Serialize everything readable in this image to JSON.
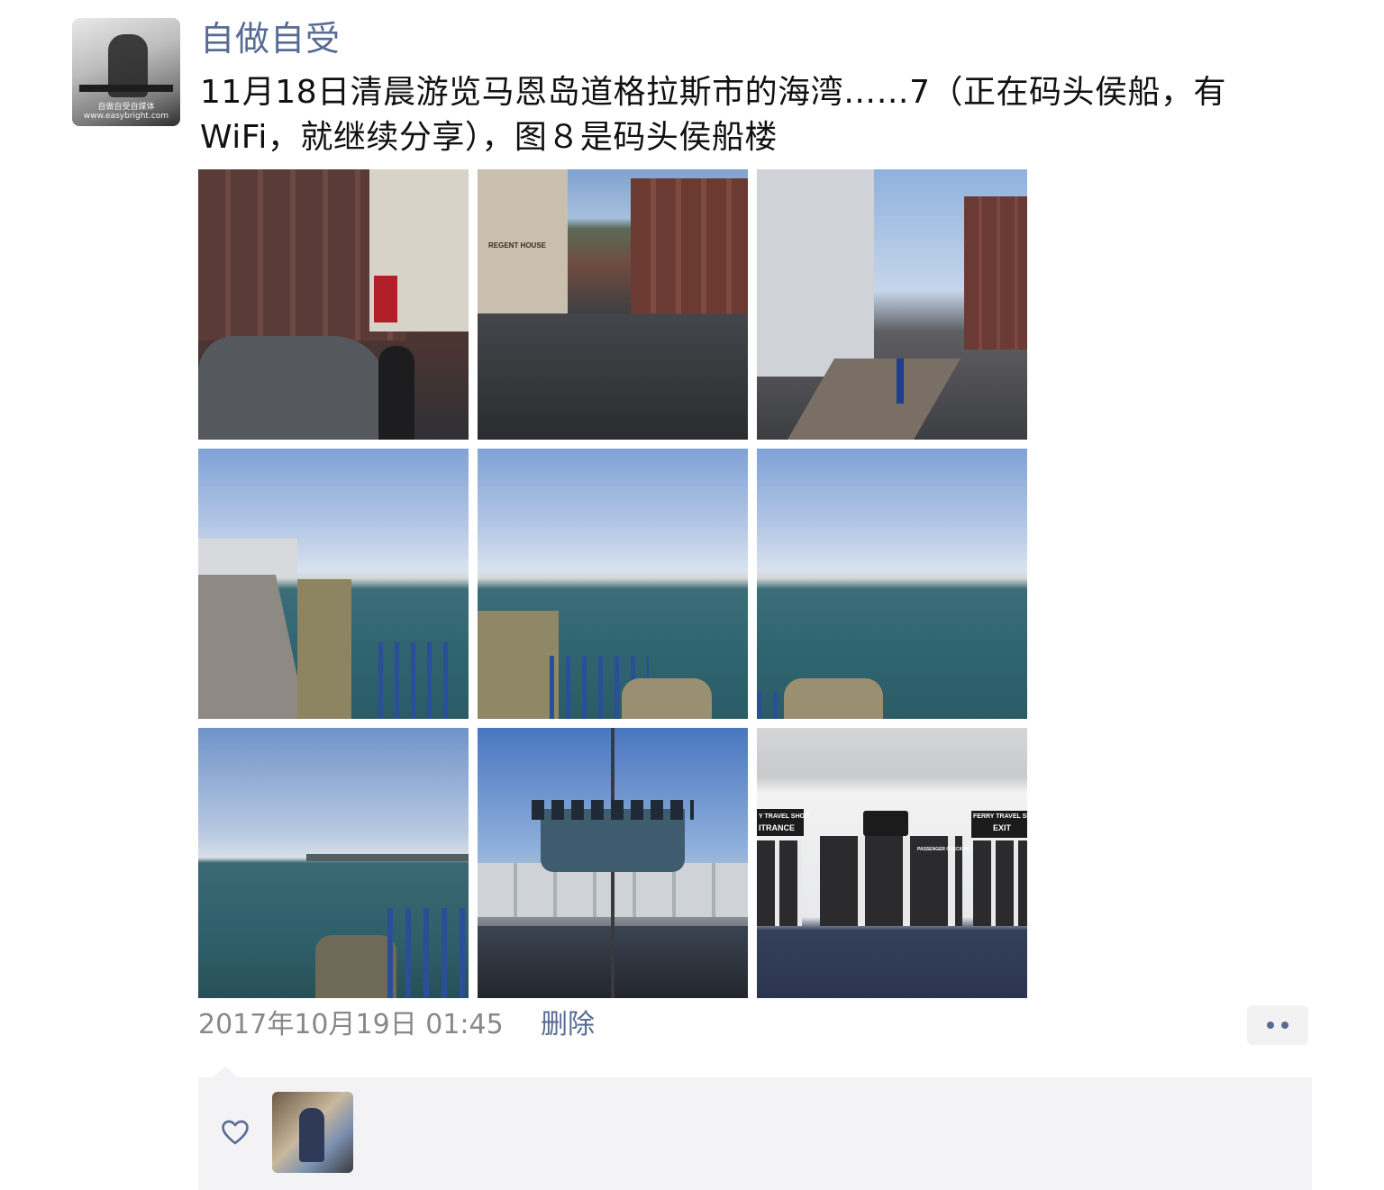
{
  "post": {
    "username": "自做自受",
    "caption": "11月18日清晨游览马恩岛道格拉斯市的海湾……7（正在码头侯船，有WiFi，就继续分享），图８是码头侯船楼",
    "avatar_watermark": "自做自受自媒体\nwww.easybright.com",
    "timestamp": "2017年10月19日 01:45",
    "delete_label": "删除",
    "photos": [
      {
        "name": "photo-1"
      },
      {
        "name": "photo-2",
        "sign": "REGENT HOUSE"
      },
      {
        "name": "photo-3"
      },
      {
        "name": "photo-4"
      },
      {
        "name": "photo-5"
      },
      {
        "name": "photo-6"
      },
      {
        "name": "photo-7"
      },
      {
        "name": "photo-8"
      },
      {
        "name": "photo-9",
        "signs": [
          "Y TRAVEL SHOP",
          "ITRANCE",
          "FERRY TRAVEL SHOP",
          "EXIT",
          "PASSENGER CHECK-IN"
        ]
      }
    ]
  },
  "icons": {
    "more": "more-dots-icon",
    "like": "heart-outline-icon"
  },
  "colors": {
    "link": "#576b95",
    "meta": "#888888",
    "panel": "#f3f3f5"
  }
}
